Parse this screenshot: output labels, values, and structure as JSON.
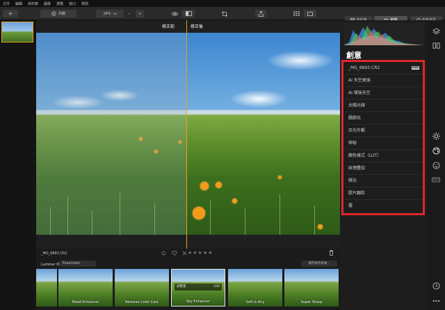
{
  "menu": [
    "文件",
    "編輯",
    "資料庫",
    "圖像",
    "瀏覽",
    "窗口",
    "幫助"
  ],
  "toolbar": {
    "add_label": "+",
    "looks_label": "外觀",
    "zoom_value": "24%",
    "zoom_minus": "−",
    "zoom_plus": "+"
  },
  "right_tabs": {
    "library": "資料庫",
    "edit": "編輯",
    "info": "影像資訊"
  },
  "viewer": {
    "before_label": "修正前",
    "after_label": "修正後",
    "filename": "_MG_6893.CR2",
    "rating_stars": "★★★★★"
  },
  "panel": {
    "title": "創意",
    "file_item": "_MG_6893.CR2",
    "raw_badge": "RAW",
    "tools": [
      "AI 天空更換",
      "AI 增強天空",
      "太陽光線",
      "戲劇化",
      "亞光外觀",
      "神秘",
      "顏色樣式（LUT）",
      "紋理疊加",
      "輝光",
      "膠片顆粒",
      "霧"
    ]
  },
  "looks": {
    "title": "Luminar 外觀：",
    "category": "Essentials",
    "save_label": "保存新的效果...",
    "items": [
      {
        "label": ""
      },
      {
        "label": "Mood Enhancer"
      },
      {
        "label": "Remove Color Cast"
      },
      {
        "label": "Sky Enhancer"
      },
      {
        "label": "Soft & Airy"
      },
      {
        "label": "Super Sharp"
      }
    ],
    "amount_label": "調整量",
    "amount_value": "100"
  },
  "colors": {
    "accent": "#e8a020",
    "highlight_box": "#e0262b"
  }
}
